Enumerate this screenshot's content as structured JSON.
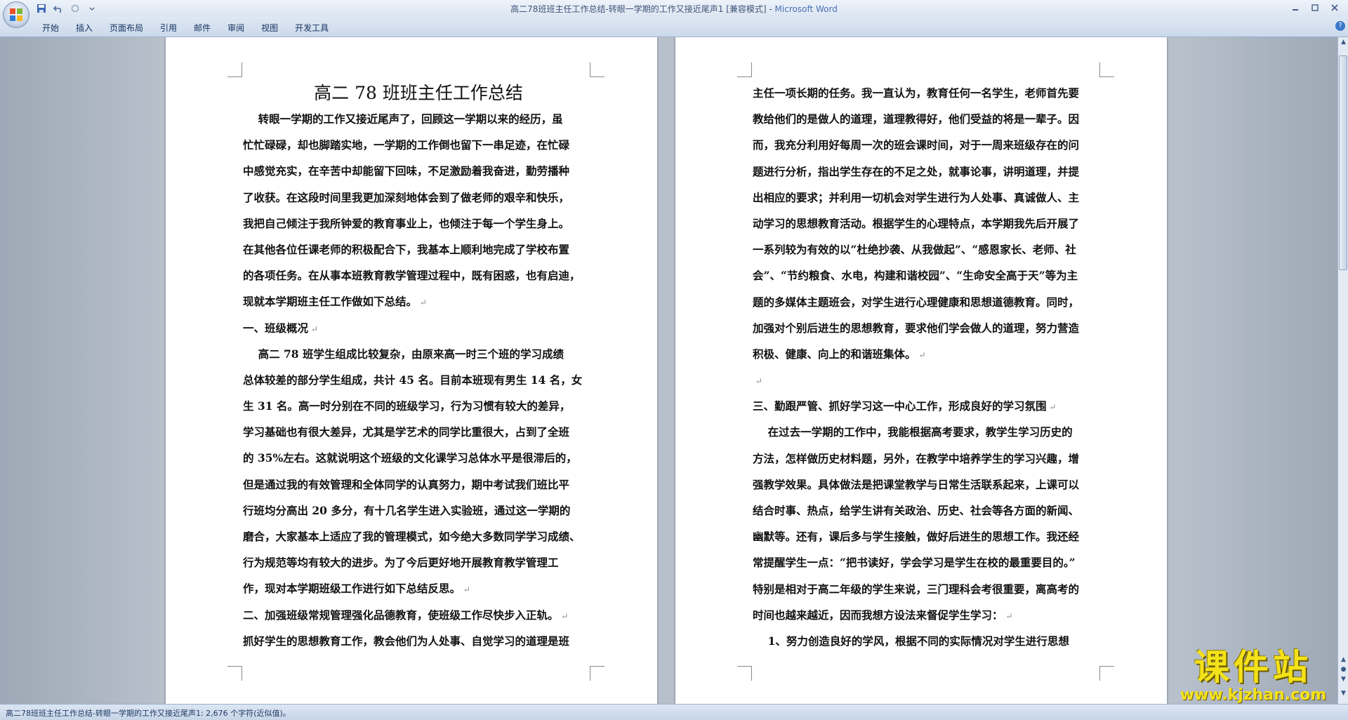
{
  "window": {
    "title": "高二78班班主任工作总结-转眼一学期的工作又接近尾声1 [兼容模式] - ",
    "app_name": "Microsoft Word"
  },
  "ribbon": {
    "tabs": [
      "开始",
      "插入",
      "页面布局",
      "引用",
      "邮件",
      "审阅",
      "视图",
      "开发工具"
    ]
  },
  "document": {
    "title": "高二 78 班班主任工作总结",
    "left_page_lines": [
      "    转眼一学期的工作又接近尾声了，回顾这一学期以来的经历，虽",
      "忙忙碌碌，却也脚踏实地，一学期的工作倒也留下一串足迹，在忙碌",
      "中感觉充实，在辛苦中却能留下回味，不足激励着我奋进，勤劳播种",
      "了收获。在这段时间里我更加深刻地体会到了做老师的艰辛和快乐，",
      "我把自己倾注于我所钟爱的教育事业上，也倾注于每一个学生身上。",
      "在其他各位任课老师的积极配合下，我基本上顺利地完成了学校布置",
      "的各项任务。在从事本班教育教学管理过程中，既有困惑，也有启迪，",
      "现就本学期班主任工作做如下总结。",
      "一、班级概况",
      "    高二 78 班学生组成比较复杂，由原来高一时三个班的学习成绩",
      "总体较差的部分学生组成，共计 45 名。目前本班现有男生 14 名，女",
      "生 31 名。高一时分别在不同的班级学习，行为习惯有较大的差异，",
      "学习基础也有很大差异，尤其是学艺术的同学比重很大，占到了全班",
      "的 35%左右。这就说明这个班级的文化课学习总体水平是很滞后的，",
      "但是通过我的有效管理和全体同学的认真努力，期中考试我们班比平",
      "行班均分高出 20 多分，有十几名学生进入实验班，通过这一学期的",
      "磨合，大家基本上适应了我的管理模式，如今绝大多数同学学习成绩、",
      "行为规范等均有较大的进步。为了今后更好地开展教育教学管理工",
      "作，现对本学期班级工作进行如下总结反思。",
      "二、加强班级常规管理强化品德教育，使班级工作尽快步入正轨。",
      "抓好学生的思想教育工作，教会他们为人处事、自觉学习的道理是班"
    ],
    "right_page_lines": [
      "主任一项长期的任务。我一直认为，教育任何一名学生，老师首先要",
      "教给他们的是做人的道理，道理教得好，他们受益的将是一辈子。因",
      "而，我充分利用好每周一次的班会课时间，对于一周来班级存在的问",
      "题进行分析，指出学生存在的不足之处，就事论事，讲明道理，并提",
      "出相应的要求；并利用一切机会对学生进行为人处事、真诚做人、主",
      "动学习的思想教育活动。根据学生的心理特点，本学期我先后开展了",
      "一系列较为有效的以“杜绝抄袭、从我做起”、“感恩家长、老师、社",
      "会”、“节约粮食、水电，构建和谐校园”、“生命安全高于天”等为主",
      "题的多媒体主题班会，对学生进行心理健康和思想道德教育。同时，",
      "加强对个别后进生的思想教育，要求他们学会做人的道理，努力营造",
      "积极、健康、向上的和谐班集体。",
      "",
      "三、勤跟严管、抓好学习这一中心工作，形成良好的学习氛围",
      "    在过去一学期的工作中，我能根据高考要求，教学生学习历史的",
      "方法，怎样做历史材料题，另外，在教学中培养学生的学习兴趣，增",
      "强教学效果。具体做法是把课堂教学与日常生活联系起来，上课可以",
      "结合时事、热点，给学生讲有关政治、历史、社会等各方面的新闻、",
      "幽默等。还有，课后多与学生接触，做好后进生的思想工作。我还经",
      "常提醒学生一点：“把书读好，学会学习是学生在校的最重要目的。”",
      "特别是相对于高二年级的学生来说，三门理科会考很重要，离高考的",
      "时间也越来越近，因而我想方设法来督促学生学习：",
      "    1、努力创造良好的学风，根据不同的实际情况对学生进行思想"
    ],
    "left_paragraph_end_lines": [
      7,
      8,
      18,
      19
    ],
    "right_paragraph_end_lines": [
      10,
      11,
      12,
      20
    ]
  },
  "statusbar": {
    "text": "高二78班班主任工作总结-转眼一学期的工作又接近尾声1: 2,676 个字符(近似值)。"
  },
  "watermark": {
    "logo": "课件站",
    "url": "www.kjzhan.com"
  },
  "colors": {
    "workspace": "#b7c0cb",
    "ribbon": "#dbe5f1",
    "watermark": "#f4e21a"
  }
}
